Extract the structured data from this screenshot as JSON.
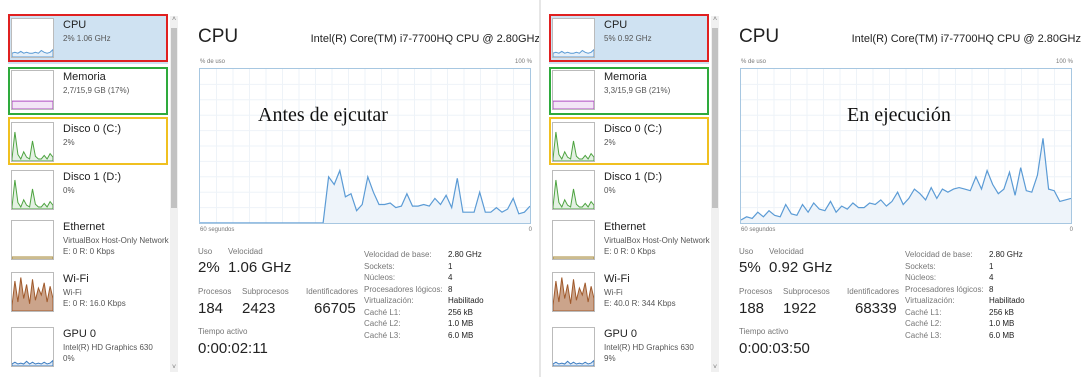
{
  "colors": {
    "cpu_line": "#5b9bd5",
    "cpu_fill": "#eef4fa",
    "mem_line": "#b04fc2",
    "disk_line": "#4da340",
    "eth_line": "#a78a3a",
    "wifi_line": "#a05a2c",
    "gpu_line": "#3c7cc0",
    "red_box": "#e02020",
    "green_box": "#2eaa3c",
    "yellow_box": "#f0c020"
  },
  "panels": [
    {
      "sidebar": [
        {
          "label": "CPU",
          "sub1": "2% 1.06 GHz",
          "sub2": "",
          "icon": "cpu-thumbnail-icon",
          "selected": true
        },
        {
          "label": "Memoria",
          "sub1": "2,7/15,9 GB (17%)",
          "sub2": "",
          "icon": "memory-thumbnail-icon",
          "selected": false
        },
        {
          "label": "Disco 0 (C:)",
          "sub1": "2%",
          "sub2": "",
          "icon": "disk-thumbnail-icon",
          "selected": false
        },
        {
          "label": "Disco 1 (D:)",
          "sub1": "0%",
          "sub2": "",
          "icon": "disk-thumbnail-icon",
          "selected": false
        },
        {
          "label": "Ethernet",
          "sub1": "VirtualBox Host-Only Network",
          "sub2": "E: 0 R: 0 Kbps",
          "icon": "ethernet-thumbnail-icon",
          "selected": false
        },
        {
          "label": "Wi-Fi",
          "sub1": "Wi-Fi",
          "sub2": "E: 0 R: 16.0 Kbps",
          "icon": "wifi-thumbnail-icon",
          "selected": false
        },
        {
          "label": "GPU 0",
          "sub1": "Intel(R) HD Graphics 630",
          "sub2": "0%",
          "icon": "gpu-thumbnail-icon",
          "selected": false
        }
      ],
      "title": "CPU",
      "processor": "Intel(R) Core(TM) i7-7700HQ CPU @ 2.80GHz",
      "usage_label": "% de uso",
      "max_label": "100 %",
      "time_label": "60 segundos",
      "zero_label": "0",
      "annotation": "Antes de ejcutar",
      "stats": {
        "uso_label": "Uso",
        "uso": "2%",
        "vel_label": "Velocidad",
        "vel": "1.06 GHz",
        "proc_label": "Procesos",
        "proc": "184",
        "sub_label": "Subprocesos",
        "sub": "2423",
        "ids_label": "Identificadores",
        "ids": "66705",
        "time_label": "Tiempo activo",
        "time": "0:00:02:11"
      },
      "specs": [
        {
          "k": "Velocidad de base:",
          "v": "2.80 GHz"
        },
        {
          "k": "Sockets:",
          "v": "1"
        },
        {
          "k": "Núcleos:",
          "v": "4"
        },
        {
          "k": "Procesadores lógicos:",
          "v": "8"
        },
        {
          "k": "Virtualización:",
          "v": "Habilitado"
        },
        {
          "k": "Caché L1:",
          "v": "256 kB"
        },
        {
          "k": "Caché L2:",
          "v": "1.0 MB"
        },
        {
          "k": "Caché L3:",
          "v": "6.0 MB"
        }
      ],
      "cpu_usage": [
        0,
        0,
        0,
        0,
        0,
        0,
        0,
        0,
        0,
        0,
        0,
        0,
        0,
        0,
        0,
        0,
        0,
        0,
        0,
        0,
        0,
        0,
        0,
        30,
        25,
        34,
        17,
        19,
        8,
        12,
        30,
        20,
        12,
        12,
        13,
        10,
        11,
        19,
        11,
        11,
        12,
        11,
        16,
        12,
        18,
        10,
        29,
        7,
        7,
        7,
        20,
        7,
        7,
        10,
        7,
        9,
        16,
        6,
        7,
        11
      ]
    },
    {
      "sidebar": [
        {
          "label": "CPU",
          "sub1": "5% 0.92 GHz",
          "sub2": "",
          "icon": "cpu-thumbnail-icon",
          "selected": true
        },
        {
          "label": "Memoria",
          "sub1": "3,3/15,9 GB (21%)",
          "sub2": "",
          "icon": "memory-thumbnail-icon",
          "selected": false
        },
        {
          "label": "Disco 0 (C:)",
          "sub1": "2%",
          "sub2": "",
          "icon": "disk-thumbnail-icon",
          "selected": false
        },
        {
          "label": "Disco 1 (D:)",
          "sub1": "0%",
          "sub2": "",
          "icon": "disk-thumbnail-icon",
          "selected": false
        },
        {
          "label": "Ethernet",
          "sub1": "VirtualBox Host-Only Network",
          "sub2": "E: 0 R: 0 Kbps",
          "icon": "ethernet-thumbnail-icon",
          "selected": false
        },
        {
          "label": "Wi-Fi",
          "sub1": "Wi-Fi",
          "sub2": "E: 40.0 R: 344 Kbps",
          "icon": "wifi-thumbnail-icon",
          "selected": false
        },
        {
          "label": "GPU 0",
          "sub1": "Intel(R) HD Graphics 630",
          "sub2": "9%",
          "icon": "gpu-thumbnail-icon",
          "selected": false
        }
      ],
      "title": "CPU",
      "processor": "Intel(R) Core(TM) i7-7700HQ CPU @ 2.80GHz",
      "usage_label": "% de uso",
      "max_label": "100 %",
      "time_label": "60 segundos",
      "zero_label": "0",
      "annotation": "En ejecución",
      "stats": {
        "uso_label": "Uso",
        "uso": "5%",
        "vel_label": "Velocidad",
        "vel": "0.92 GHz",
        "proc_label": "Procesos",
        "proc": "188",
        "sub_label": "Subprocesos",
        "sub": "1922",
        "ids_label": "Identificadores",
        "ids": "68339",
        "time_label": "Tiempo activo",
        "time": "0:00:03:50"
      },
      "specs": [
        {
          "k": "Velocidad de base:",
          "v": "2.80 GHz"
        },
        {
          "k": "Sockets:",
          "v": "1"
        },
        {
          "k": "Núcleos:",
          "v": "4"
        },
        {
          "k": "Procesadores lógicos:",
          "v": "8"
        },
        {
          "k": "Virtualización:",
          "v": "Habilitado"
        },
        {
          "k": "Caché L1:",
          "v": "256 kB"
        },
        {
          "k": "Caché L2:",
          "v": "1.0 MB"
        },
        {
          "k": "Caché L3:",
          "v": "6.0 MB"
        }
      ],
      "cpu_usage": [
        2,
        4,
        3,
        7,
        4,
        8,
        5,
        4,
        12,
        6,
        5,
        12,
        7,
        13,
        9,
        8,
        14,
        7,
        11,
        9,
        13,
        10,
        10,
        13,
        12,
        15,
        11,
        14,
        20,
        12,
        16,
        22,
        19,
        15,
        23,
        16,
        22,
        20,
        22,
        23,
        22,
        21,
        30,
        22,
        34,
        25,
        19,
        22,
        33,
        18,
        36,
        21,
        20,
        31,
        55,
        22,
        21,
        14,
        15,
        16
      ]
    }
  ]
}
